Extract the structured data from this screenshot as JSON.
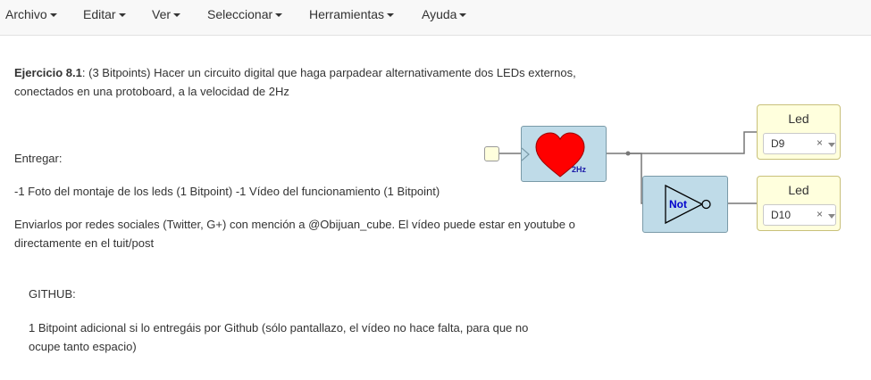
{
  "menubar": {
    "items": [
      {
        "label": "Archivo"
      },
      {
        "label": "Editar"
      },
      {
        "label": "Ver"
      },
      {
        "label": "Seleccionar"
      },
      {
        "label": "Herramientas"
      },
      {
        "label": "Ayuda"
      }
    ]
  },
  "text": {
    "exercise_title": "Ejercicio 8.1",
    "exercise_body": ": (3 Bitpoints) Hacer un circuito digital que haga parpadear alternativamente dos LEDs externos,",
    "exercise_body2": "conectados en una protoboard, a la velocidad de 2Hz",
    "deliver": "Entregar:",
    "deliver_items": "-1 Foto del montaje de los leds (1 Bitpoint) -1 Vídeo del funcionamiento (1 Bitpoint)",
    "social_line1": "Enviarlos por redes sociales (Twitter, G+) con mención a @Obijuan_cube. El vídeo puede estar en youtube o",
    "social_line2": "directamente en el tuit/post",
    "github_title": "GITHUB:",
    "github_line1": "1 Bitpoint adicional si lo entregáis por Github (sólo pantallazo, el vídeo no hace falta, para que no",
    "github_line2": "ocupe tanto espacio)"
  },
  "circuit": {
    "heart_label": "2Hz",
    "not_label": "Not",
    "leds": [
      {
        "title": "Led",
        "pin": "D9",
        "clear": "×"
      },
      {
        "title": "Led",
        "pin": "D10",
        "clear": "×"
      }
    ],
    "colors": {
      "block_fill": "#bfdbe8",
      "block_border": "#7a9aa8",
      "heart": "#ff0000",
      "led_fill": "#ffffdd",
      "wire": "#777777",
      "not_label": "#0000cc",
      "hz_label": "#1a1aa8"
    }
  }
}
